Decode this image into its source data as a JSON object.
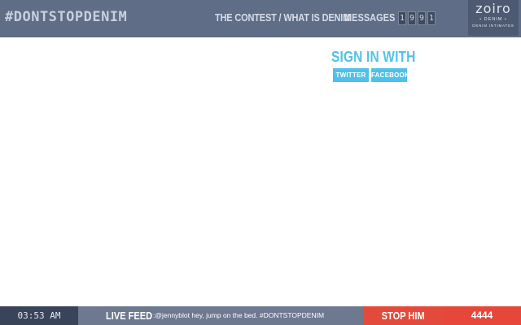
{
  "header": {
    "hashtag": "#DONTSTOPDENIM",
    "nav": {
      "contest": "THE CONTEST",
      "separator": " / ",
      "what_is_denim": "WHAT IS DENIM",
      "messages": "MESSAGES"
    },
    "counter_digits": [
      "1",
      "9",
      "9",
      "1"
    ],
    "logo": {
      "name": "zoiro",
      "line1": "• DENIM •",
      "line2": "DENIM INTIMATES"
    }
  },
  "signin": {
    "heading": "SIGN IN WITH",
    "twitter_label": "TWITTER",
    "facebook_label": "FACEBOOK"
  },
  "footer": {
    "time": "03:53 AM",
    "feed_label": "LIVE FEED",
    "feed_text": ":@jennyblot hey, jump on the bed. #DONTSTOPDENIM",
    "stop_label": "STOP HIM",
    "score": "4444"
  },
  "colors": {
    "header_bg": "#5f6d87",
    "accent_blue": "#4fc0ea",
    "accent_red": "#e34a3b",
    "clock_bg": "#3a4458",
    "feed_bg": "#6e7990"
  }
}
